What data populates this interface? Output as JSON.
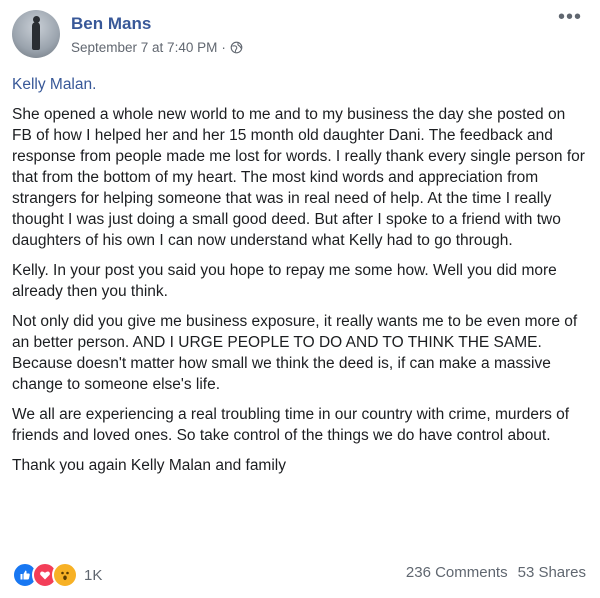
{
  "post": {
    "author": "Ben Mans",
    "timestamp": "September 7 at 7:40 PM",
    "separator": "·",
    "privacy_icon": "globe-icon",
    "more_icon": "more-options-icon",
    "more_glyph": "•••"
  },
  "content": {
    "greeting": "Kelly Malan.",
    "paragraphs": [
      "She opened a whole new world to me and to my business the day she posted on FB of how I helped her and her 15 month old daughter Dani. The feedback and response from people made me lost for words. I really thank every single person for that from the bottom of my heart. The most kind words and appreciation from strangers for helping someone that was in real need of help. At the time I really thought I was just doing a small good deed. But after I spoke to a friend with two daughters of his own I can now understand what Kelly had to go through.",
      "Kelly. In your post you said you hope to repay me some how. Well you did more already then you think.",
      "Not only did you give me business exposure, it really wants me to be even more of an better person. AND I URGE PEOPLE TO DO AND TO THINK THE SAME. Because doesn't matter how small we think the deed is, if can make a massive change to someone else's life.",
      "We all are experiencing a real troubling time in our country with crime, murders of friends and loved ones. So take control of the things we do have control about.",
      "Thank you again Kelly Malan and family"
    ]
  },
  "engagement": {
    "reaction_icons": [
      "like-reaction-icon",
      "love-reaction-icon",
      "wow-reaction-icon"
    ],
    "reaction_count": "1K",
    "comments": "236 Comments",
    "shares": "53 Shares"
  },
  "colors": {
    "link": "#385898",
    "meta": "#616770",
    "like": "#1877f2",
    "love": "#f33e58",
    "wow": "#f7b125"
  }
}
